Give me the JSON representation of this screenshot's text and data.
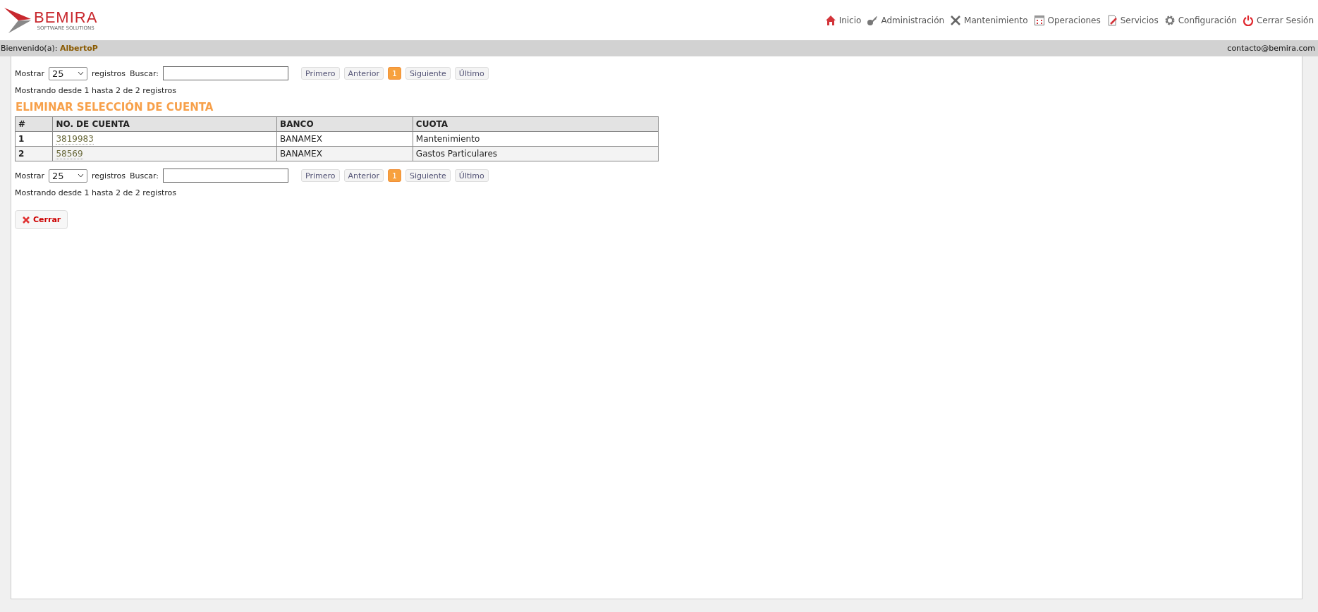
{
  "logo": {
    "name": "BEMIRA",
    "tagline": "SOFTWARE SOLUTIONS"
  },
  "nav": [
    {
      "label": "Inicio",
      "kind": "home"
    },
    {
      "label": "Administración",
      "kind": "key"
    },
    {
      "label": "Mantenimiento",
      "kind": "tools"
    },
    {
      "label": "Operaciones",
      "kind": "calc"
    },
    {
      "label": "Servicios",
      "kind": "doc"
    },
    {
      "label": "Configuración",
      "kind": "gear"
    },
    {
      "label": "Cerrar Sesión",
      "kind": "power"
    }
  ],
  "user_bar": {
    "greeting": "Bienvenido(a):",
    "user": "AlbertoP",
    "email": "contacto@bemira.com"
  },
  "top_controls": {
    "show_label": "Mostrar",
    "page_size": "25",
    "records_label": "registros",
    "search_label": "Buscar:",
    "pager": [
      {
        "label": "Primero",
        "selected": false
      },
      {
        "label": "Anterior",
        "selected": false
      },
      {
        "label": "1",
        "selected": true
      },
      {
        "label": "Siguiente",
        "selected": false
      },
      {
        "label": "Último",
        "selected": false
      }
    ],
    "info": "Mostrando desde 1 hasta 2 de 2 registros"
  },
  "title": "ELIMINAR SELECCIÓN DE CUENTA",
  "table": {
    "columns": [
      "#",
      "NO. DE CUENTA",
      "BANCO",
      "CUOTA"
    ],
    "rows": [
      [
        "1",
        "3819983",
        "BANAMEX",
        "Mantenimiento"
      ],
      [
        "2",
        "58569",
        "BANAMEX",
        "Gastos Particulares"
      ]
    ]
  },
  "bottom_controls": {
    "show_label": "Mostrar",
    "page_size": "25",
    "records_label": "registros",
    "search_label": "Buscar:",
    "pager": [
      {
        "label": "Primero",
        "selected": false
      },
      {
        "label": "Anterior",
        "selected": false
      },
      {
        "label": "1",
        "selected": true
      },
      {
        "label": "Siguiente",
        "selected": false
      },
      {
        "label": "Último",
        "selected": false
      }
    ],
    "info": "Mostrando desde 1 hasta 2 de 2 registros"
  },
  "close_button": {
    "label": "Cerrar"
  }
}
